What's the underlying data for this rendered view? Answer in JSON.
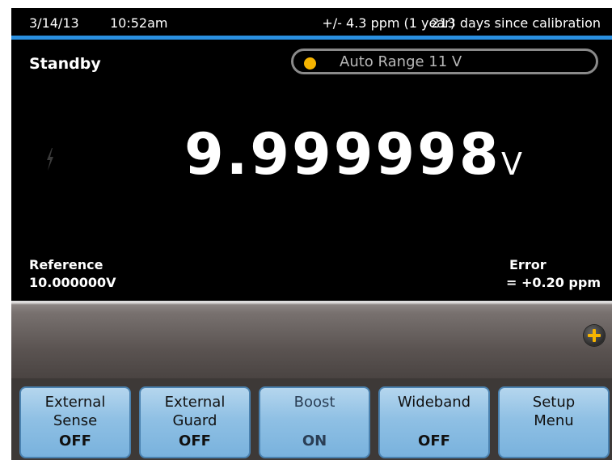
{
  "status": {
    "date": "3/14/13",
    "time": "10:52am",
    "accuracy": "+/- 4.3 ppm (1 year)",
    "calibration": "213 days since calibration"
  },
  "mode": "Standby",
  "range": {
    "label": "Auto Range 11 V",
    "indicator_color": "#f6b400"
  },
  "reading": {
    "value": "9.999998",
    "unit": "V"
  },
  "reference": {
    "label": "Reference",
    "value": "10.000000V"
  },
  "error": {
    "label": "Error",
    "value": "=  +0.20 ppm"
  },
  "softkeys": [
    {
      "line1": "External",
      "line2": "Sense",
      "state": "OFF"
    },
    {
      "line1": "External",
      "line2": "Guard",
      "state": "OFF"
    },
    {
      "line1": "Boost",
      "line2": "",
      "state": "ON"
    },
    {
      "line1": "Wideband",
      "line2": "",
      "state": "OFF"
    },
    {
      "line1": "Setup",
      "line2": "Menu",
      "state": ""
    }
  ],
  "colors": {
    "accent_line": "#2a8fe0",
    "softkey": "#8fc0e4",
    "plus": "#f6b400"
  },
  "icons": {
    "hazard": "lightning-bolt-icon",
    "more": "plus-icon"
  }
}
